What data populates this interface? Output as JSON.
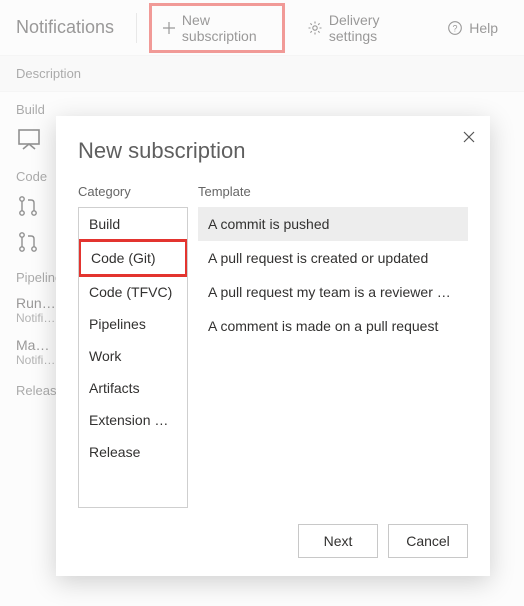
{
  "toolbar": {
    "title": "Notifications",
    "new_subscription": "New subscription",
    "delivery_settings": "Delivery settings",
    "help": "Help"
  },
  "columns": {
    "description": "Description"
  },
  "background": {
    "sections": [
      {
        "label": "Build"
      },
      {
        "label": "Code"
      },
      {
        "label": "Pipelines",
        "items": [
          {
            "line1": "Run stage waiting for approval",
            "line2": "Notifies when a stage is waiting"
          },
          {
            "line1": "Manual validation",
            "line2": "Notifies when validation is pending"
          }
        ]
      },
      {
        "label": "Release"
      }
    ]
  },
  "dialog": {
    "title": "New subscription",
    "headers": {
      "category": "Category",
      "template": "Template"
    },
    "categories": [
      "Build",
      "Code (Git)",
      "Code (TFVC)",
      "Pipelines",
      "Work",
      "Artifacts",
      "Extension management",
      "Release"
    ],
    "selected_category_index": 1,
    "templates": [
      "A commit is pushed",
      "A pull request is created or updated",
      "A pull request my team is a reviewer on is updated",
      "A comment is made on a pull request"
    ],
    "selected_template_index": 0,
    "buttons": {
      "next": "Next",
      "cancel": "Cancel"
    }
  }
}
